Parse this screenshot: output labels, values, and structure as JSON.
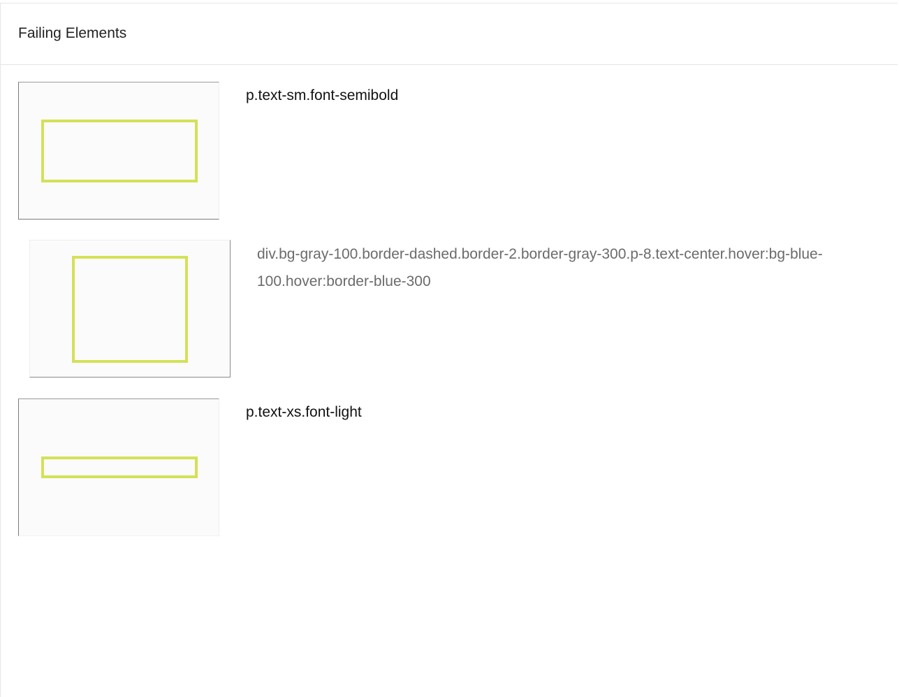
{
  "header": {
    "title": "Failing Elements"
  },
  "elements": [
    {
      "selector": "p.text-sm.font-semibold"
    },
    {
      "selector": "div.bg-gray-100.border-dashed.border-2.border-gray-300.p-8.text-center.hover:bg-blue-100.hover:border-blue-300"
    },
    {
      "selector": "p.text-xs.font-light"
    }
  ],
  "colors": {
    "highlight": "#d4e157",
    "text_primary": "#111111",
    "text_muted": "#6b6b6b"
  }
}
